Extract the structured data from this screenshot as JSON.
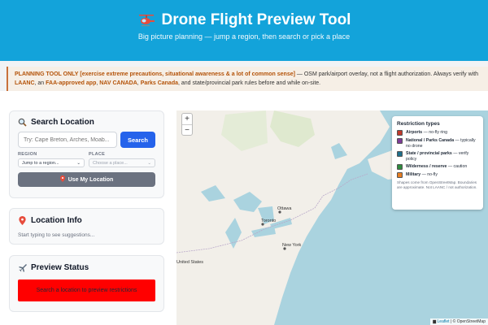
{
  "header": {
    "title": "Drone Flight Preview Tool",
    "subtitle": "Big picture planning — jump a region, then search or pick a place",
    "bg_color": "#13a3da"
  },
  "warning": {
    "label": "PLANNING TOOL ONLY",
    "label_bracket": "[exercise extreme precautions, situational awareness & a lot of common sense]",
    "text1": " — OSM park/airport overlay, not a flight authorization. Always verify with ",
    "laanc": "LAANC",
    "text2": ", an ",
    "faa": "FAA-approved app",
    "comma1": ", ",
    "navcan": "NAV CANADA",
    "comma2": ", ",
    "parks": "Parks Canada",
    "text3": ", and state/provincial park rules before and while on-site."
  },
  "search_card": {
    "title": "Search Location",
    "icon": "magnifier-icon",
    "input_placeholder": "Try: Cape Breton, Arches, Moab...",
    "search_label": "Search",
    "region_label": "REGION",
    "region_value": "Jump to a region...",
    "place_label": "PLACE",
    "place_value": "Choose a place...",
    "location_button": "Use My Location"
  },
  "info_card": {
    "title": "Location Info",
    "icon": "pin-icon",
    "text": "Start typing to see suggestions..."
  },
  "status_card": {
    "title": "Preview Status",
    "icon": "airplane-icon",
    "status_text": "Search a location to preview restrictions",
    "status_color": "#ff0000"
  },
  "map": {
    "zoom_in": "+",
    "zoom_out": "−",
    "labels": [
      "Ottawa",
      "Toronto",
      "New York",
      "United States"
    ],
    "attribution_leaflet": "Leaflet",
    "attribution_rest": " | © OpenStreetMap"
  },
  "legend": {
    "title": "Restriction types",
    "items": [
      {
        "name": "Airports",
        "desc": " — no-fly ring",
        "color": "#c0392b"
      },
      {
        "name": "National / Parks Canada",
        "desc": " — typically no drone",
        "color": "#7d3c98"
      },
      {
        "name": "State / provincial parks",
        "desc": " — verify policy",
        "color": "#1f6f8b"
      },
      {
        "name": "Wilderness / reserve",
        "desc": " — caution",
        "color": "#2e8b3e"
      },
      {
        "name": "Military",
        "desc": " — no-fly",
        "color": "#e67e22"
      }
    ],
    "note": "Shapes come from OpenStreetMap. Boundaries are approximate. Not LAANC / not authorization."
  }
}
